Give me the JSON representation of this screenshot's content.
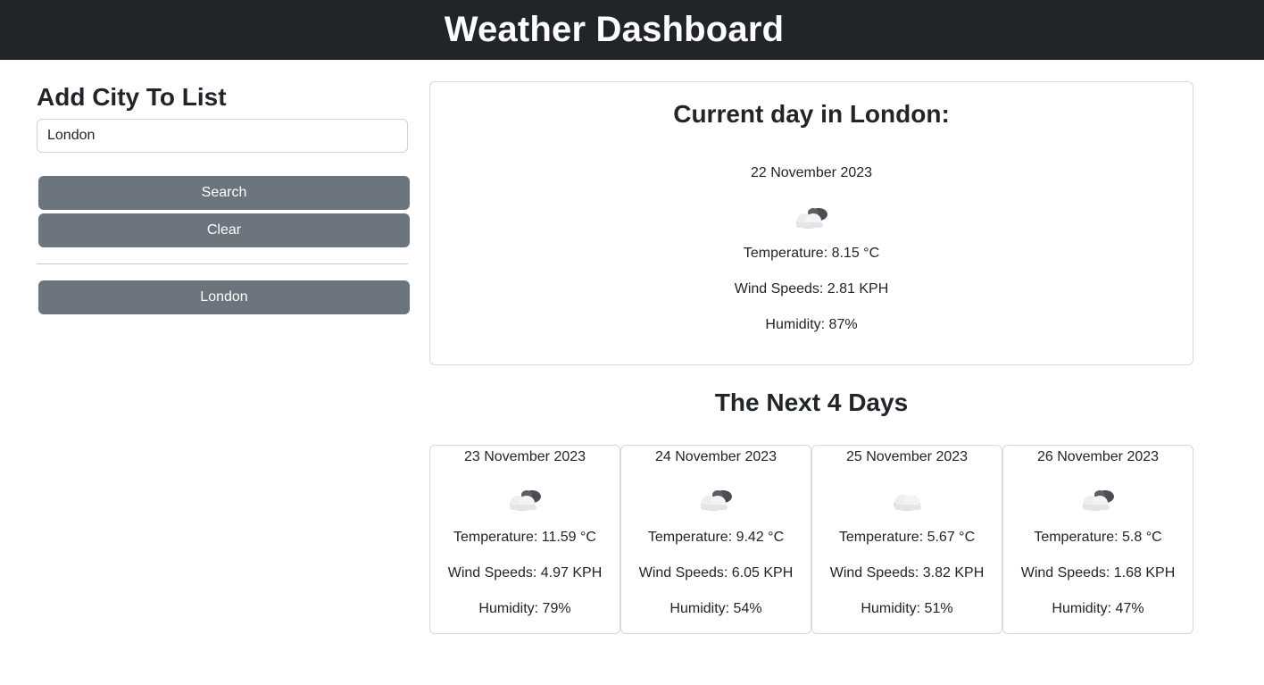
{
  "header": {
    "title": "Weather Dashboard"
  },
  "sidebar": {
    "heading": "Add City To List",
    "input_value": "London",
    "search_label": "Search",
    "clear_label": "Clear",
    "history": [
      "London"
    ]
  },
  "current": {
    "heading": "Current day in London:",
    "date": "22 November 2023",
    "icon": "partly-cloudy-icon",
    "temperature": "Temperature: 8.15 °C",
    "wind": "Wind Speeds: 2.81 KPH",
    "humidity": "Humidity: 87%"
  },
  "forecast": {
    "heading": "The Next 4 Days",
    "days": [
      {
        "date": "23 November 2023",
        "icon": "partly-cloudy-icon",
        "temperature": "Temperature: 11.59 °C",
        "wind": "Wind Speeds: 4.97 KPH",
        "humidity": "Humidity: 79%"
      },
      {
        "date": "24 November 2023",
        "icon": "partly-cloudy-icon",
        "temperature": "Temperature: 9.42 °C",
        "wind": "Wind Speeds: 6.05 KPH",
        "humidity": "Humidity: 54%"
      },
      {
        "date": "25 November 2023",
        "icon": "cloud-icon",
        "temperature": "Temperature: 5.67 °C",
        "wind": "Wind Speeds: 3.82 KPH",
        "humidity": "Humidity: 51%"
      },
      {
        "date": "26 November 2023",
        "icon": "partly-cloudy-icon",
        "temperature": "Temperature: 5.8 °C",
        "wind": "Wind Speeds: 1.68 KPH",
        "humidity": "Humidity: 47%"
      }
    ]
  },
  "colors": {
    "header_bg": "#212529",
    "button_bg": "#6c757d"
  }
}
